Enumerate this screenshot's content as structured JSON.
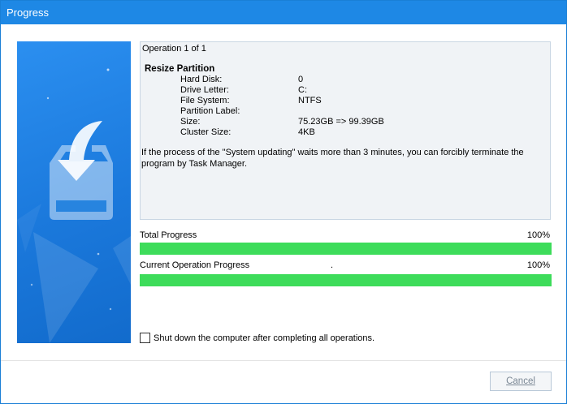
{
  "window": {
    "title": "Progress"
  },
  "operation": {
    "header": "Operation 1 of 1",
    "name": "Resize Partition",
    "properties": [
      {
        "label": "Hard Disk:",
        "value": "0"
      },
      {
        "label": "Drive Letter:",
        "value": "C:"
      },
      {
        "label": "File System:",
        "value": "NTFS"
      },
      {
        "label": "Partition Label:",
        "value": ""
      },
      {
        "label": "Size:",
        "value": "75.23GB => 99.39GB"
      },
      {
        "label": "Cluster Size:",
        "value": "4KB"
      }
    ],
    "notice": "If the process of the \"System updating\" waits more than 3 minutes, you can forcibly terminate the program by Task Manager."
  },
  "total_progress": {
    "label": "Total Progress",
    "percent_text": "100%",
    "value": 1.0
  },
  "current_progress": {
    "label": "Current Operation Progress",
    "marker": ".",
    "percent_text": "100%",
    "value": 1.0
  },
  "shutdown_option": {
    "label": "Shut down the computer after completing all operations.",
    "checked": false
  },
  "buttons": {
    "cancel": "Cancel"
  },
  "colors": {
    "titlebar": "#1e88e5",
    "progress_fill": "#3ddc5a",
    "banner": "#1b79dc"
  },
  "icons": {
    "banner_illustration": "download-to-disk-icon"
  }
}
